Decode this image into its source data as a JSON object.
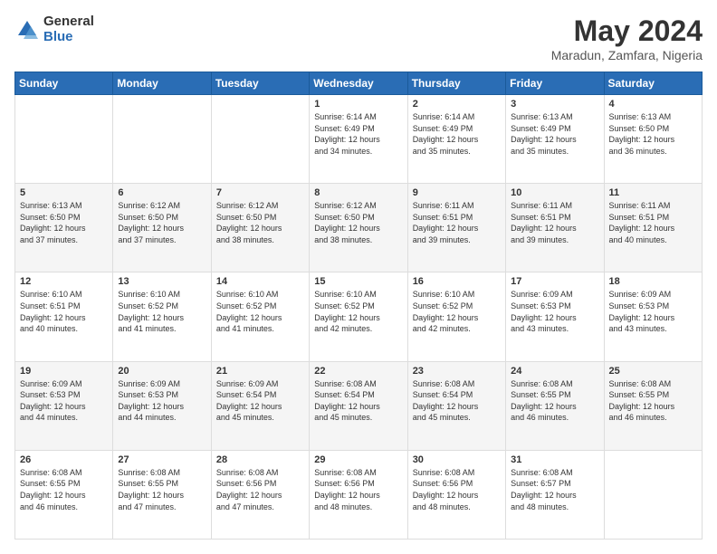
{
  "logo": {
    "general": "General",
    "blue": "Blue"
  },
  "title": "May 2024",
  "subtitle": "Maradun, Zamfara, Nigeria",
  "days_header": [
    "Sunday",
    "Monday",
    "Tuesday",
    "Wednesday",
    "Thursday",
    "Friday",
    "Saturday"
  ],
  "weeks": [
    [
      {
        "day": "",
        "info": ""
      },
      {
        "day": "",
        "info": ""
      },
      {
        "day": "",
        "info": ""
      },
      {
        "day": "1",
        "info": "Sunrise: 6:14 AM\nSunset: 6:49 PM\nDaylight: 12 hours\nand 34 minutes."
      },
      {
        "day": "2",
        "info": "Sunrise: 6:14 AM\nSunset: 6:49 PM\nDaylight: 12 hours\nand 35 minutes."
      },
      {
        "day": "3",
        "info": "Sunrise: 6:13 AM\nSunset: 6:49 PM\nDaylight: 12 hours\nand 35 minutes."
      },
      {
        "day": "4",
        "info": "Sunrise: 6:13 AM\nSunset: 6:50 PM\nDaylight: 12 hours\nand 36 minutes."
      }
    ],
    [
      {
        "day": "5",
        "info": "Sunrise: 6:13 AM\nSunset: 6:50 PM\nDaylight: 12 hours\nand 37 minutes."
      },
      {
        "day": "6",
        "info": "Sunrise: 6:12 AM\nSunset: 6:50 PM\nDaylight: 12 hours\nand 37 minutes."
      },
      {
        "day": "7",
        "info": "Sunrise: 6:12 AM\nSunset: 6:50 PM\nDaylight: 12 hours\nand 38 minutes."
      },
      {
        "day": "8",
        "info": "Sunrise: 6:12 AM\nSunset: 6:50 PM\nDaylight: 12 hours\nand 38 minutes."
      },
      {
        "day": "9",
        "info": "Sunrise: 6:11 AM\nSunset: 6:51 PM\nDaylight: 12 hours\nand 39 minutes."
      },
      {
        "day": "10",
        "info": "Sunrise: 6:11 AM\nSunset: 6:51 PM\nDaylight: 12 hours\nand 39 minutes."
      },
      {
        "day": "11",
        "info": "Sunrise: 6:11 AM\nSunset: 6:51 PM\nDaylight: 12 hours\nand 40 minutes."
      }
    ],
    [
      {
        "day": "12",
        "info": "Sunrise: 6:10 AM\nSunset: 6:51 PM\nDaylight: 12 hours\nand 40 minutes."
      },
      {
        "day": "13",
        "info": "Sunrise: 6:10 AM\nSunset: 6:52 PM\nDaylight: 12 hours\nand 41 minutes."
      },
      {
        "day": "14",
        "info": "Sunrise: 6:10 AM\nSunset: 6:52 PM\nDaylight: 12 hours\nand 41 minutes."
      },
      {
        "day": "15",
        "info": "Sunrise: 6:10 AM\nSunset: 6:52 PM\nDaylight: 12 hours\nand 42 minutes."
      },
      {
        "day": "16",
        "info": "Sunrise: 6:10 AM\nSunset: 6:52 PM\nDaylight: 12 hours\nand 42 minutes."
      },
      {
        "day": "17",
        "info": "Sunrise: 6:09 AM\nSunset: 6:53 PM\nDaylight: 12 hours\nand 43 minutes."
      },
      {
        "day": "18",
        "info": "Sunrise: 6:09 AM\nSunset: 6:53 PM\nDaylight: 12 hours\nand 43 minutes."
      }
    ],
    [
      {
        "day": "19",
        "info": "Sunrise: 6:09 AM\nSunset: 6:53 PM\nDaylight: 12 hours\nand 44 minutes."
      },
      {
        "day": "20",
        "info": "Sunrise: 6:09 AM\nSunset: 6:53 PM\nDaylight: 12 hours\nand 44 minutes."
      },
      {
        "day": "21",
        "info": "Sunrise: 6:09 AM\nSunset: 6:54 PM\nDaylight: 12 hours\nand 45 minutes."
      },
      {
        "day": "22",
        "info": "Sunrise: 6:08 AM\nSunset: 6:54 PM\nDaylight: 12 hours\nand 45 minutes."
      },
      {
        "day": "23",
        "info": "Sunrise: 6:08 AM\nSunset: 6:54 PM\nDaylight: 12 hours\nand 45 minutes."
      },
      {
        "day": "24",
        "info": "Sunrise: 6:08 AM\nSunset: 6:55 PM\nDaylight: 12 hours\nand 46 minutes."
      },
      {
        "day": "25",
        "info": "Sunrise: 6:08 AM\nSunset: 6:55 PM\nDaylight: 12 hours\nand 46 minutes."
      }
    ],
    [
      {
        "day": "26",
        "info": "Sunrise: 6:08 AM\nSunset: 6:55 PM\nDaylight: 12 hours\nand 46 minutes."
      },
      {
        "day": "27",
        "info": "Sunrise: 6:08 AM\nSunset: 6:55 PM\nDaylight: 12 hours\nand 47 minutes."
      },
      {
        "day": "28",
        "info": "Sunrise: 6:08 AM\nSunset: 6:56 PM\nDaylight: 12 hours\nand 47 minutes."
      },
      {
        "day": "29",
        "info": "Sunrise: 6:08 AM\nSunset: 6:56 PM\nDaylight: 12 hours\nand 48 minutes."
      },
      {
        "day": "30",
        "info": "Sunrise: 6:08 AM\nSunset: 6:56 PM\nDaylight: 12 hours\nand 48 minutes."
      },
      {
        "day": "31",
        "info": "Sunrise: 6:08 AM\nSunset: 6:57 PM\nDaylight: 12 hours\nand 48 minutes."
      },
      {
        "day": "",
        "info": ""
      }
    ]
  ]
}
